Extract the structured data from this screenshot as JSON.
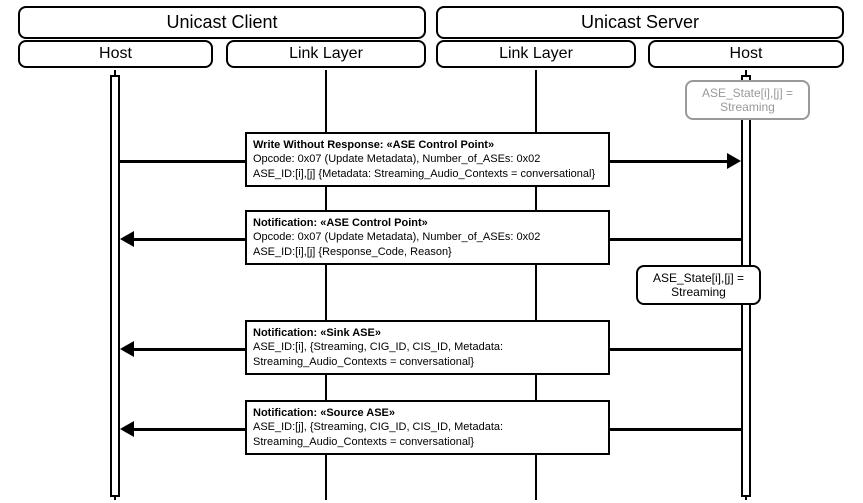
{
  "headers": {
    "client": "Unicast Client",
    "server": "Unicast Server",
    "client_host": "Host",
    "client_link": "Link Layer",
    "server_link": "Link Layer",
    "server_host": "Host"
  },
  "states": {
    "initial": "ASE_State[i],[j] = Streaming",
    "final": "ASE_State[i],[j] = Streaming"
  },
  "messages": {
    "m1_title": "Write Without Response: «ASE Control Point»",
    "m1_line1": "Opcode: 0x07 (Update Metadata), Number_of_ASEs: 0x02",
    "m1_line2": "ASE_ID:[i],[j] {Metadata: Streaming_Audio_Contexts = conversational}",
    "m2_title": "Notification: «ASE Control Point»",
    "m2_line1": "Opcode: 0x07 (Update Metadata), Number_of_ASEs: 0x02",
    "m2_line2": "ASE_ID:[i],[j] {Response_Code, Reason}",
    "m3_title": "Notification: «Sink ASE»",
    "m3_line1": "ASE_ID:[i], {Streaming, CIG_ID, CIS_ID, Metadata: Streaming_Audio_Contexts = conversational}",
    "m4_title": "Notification: «Source ASE»",
    "m4_line1": "ASE_ID:[j], {Streaming, CIG_ID, CIS_ID, Metadata: Streaming_Audio_Contexts = conversational}"
  }
}
